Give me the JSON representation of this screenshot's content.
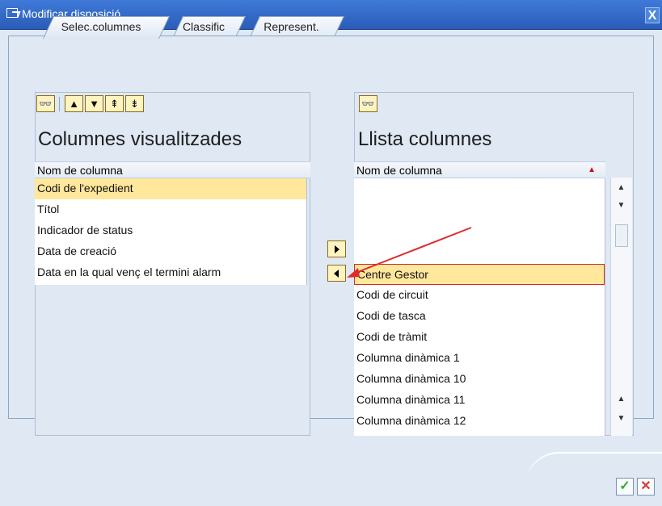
{
  "window": {
    "title": "Modificar disposició",
    "close": "X"
  },
  "tabs": [
    "Selec.columnes",
    "Classific",
    "Represent."
  ],
  "left_panel": {
    "title": "Columnes visualitzades",
    "header": "Nom de columna",
    "items": [
      "Codi de l'expedient",
      "Títol",
      "Indicador de status",
      "Data de creació",
      "Data en la qual venç el termini alarm"
    ],
    "toolbar_icons": [
      "binoculars-icon",
      "up-icon",
      "down-icon",
      "top-icon",
      "bottom-icon"
    ]
  },
  "right_panel": {
    "title": "Llista columnes",
    "header": "Nom de columna",
    "items": [
      "Centre Gestor",
      "Codi de circuit",
      "Codi de tasca",
      "Codi de tràmit",
      "Columna dinàmica 1",
      "Columna dinàmica 10",
      "Columna dinàmica 11",
      "Columna dinàmica 12"
    ]
  },
  "colors": {
    "titlebar": "#2f6ccc",
    "panel_bg": "#dfe8f3",
    "selected_row": "#ffe79b",
    "arrow": "#e02b2b",
    "confirm": "#38a82d",
    "cancel": "#d43a2f"
  }
}
